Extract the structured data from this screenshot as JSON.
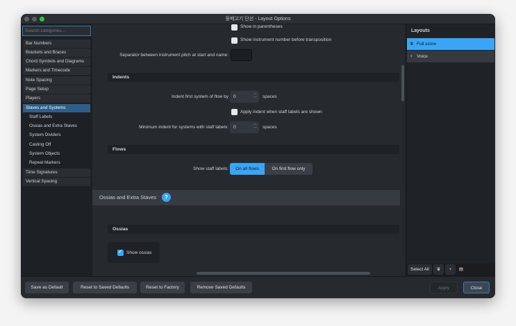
{
  "window": {
    "title": "둥베고기 단선 - Layout Options"
  },
  "sidebar": {
    "search_placeholder": "Search categories...",
    "items": [
      {
        "label": "Bar Numbers"
      },
      {
        "label": "Brackets and Braces"
      },
      {
        "label": "Chord Symbols and Diagrams"
      },
      {
        "label": "Markers and Timecode"
      },
      {
        "label": "Note Spacing"
      },
      {
        "label": "Page Setup"
      },
      {
        "label": "Players"
      },
      {
        "label": "Staves and Systems"
      },
      {
        "label": "Staff Labels"
      },
      {
        "label": "Ossias and Extra Staves"
      },
      {
        "label": "System Dividers"
      },
      {
        "label": "Casting Off"
      },
      {
        "label": "System Objects"
      },
      {
        "label": "Repeat Markers"
      },
      {
        "label": "Time Signatures"
      },
      {
        "label": "Vertical Spacing"
      }
    ]
  },
  "main": {
    "show_in_parentheses": "Show in parentheses",
    "show_instrument_number": "Show instrument number before transposition",
    "separator_label": "Separator between instrument pitch at start and name:",
    "separator_value": "",
    "indents_heading": "Indents",
    "indent_first_label": "Indent first system of flow by",
    "indent_first_value": "0",
    "spaces": "spaces",
    "apply_indent_label": "Apply indent when staff labels are shown",
    "min_indent_label": "Minimum indent for systems with staff labels:",
    "min_indent_value": "0",
    "flows_heading": "Flows",
    "show_staff_labels_label": "Show staff labels:",
    "on_all_flows": "On all flows",
    "on_first_flow_only": "On first flow only",
    "ossias_section": "Ossias and Extra Staves",
    "help": "?",
    "ossias_heading": "Ossias",
    "show_ossias": "Show ossias"
  },
  "layouts": {
    "title": "Layouts",
    "items": [
      {
        "label": "Full score"
      },
      {
        "label": "Voice"
      }
    ],
    "select_all": "Select All"
  },
  "footer": {
    "save_default": "Save as Default",
    "reset_saved": "Reset to Saved Defaults",
    "reset_factory": "Reset to Factory",
    "remove_saved": "Remove Saved Defaults",
    "apply": "Apply",
    "close": "Close"
  },
  "colors": {
    "accent": "#3aa5f5",
    "selected": "#2f5d87"
  }
}
